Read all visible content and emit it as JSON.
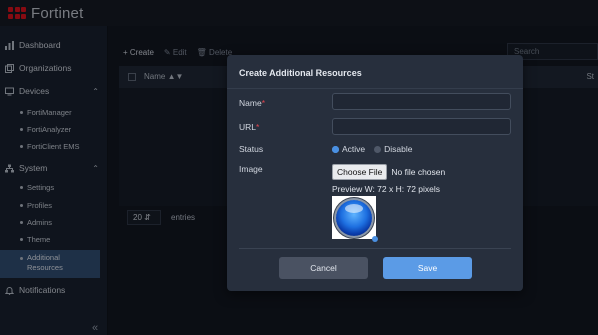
{
  "brand": {
    "name": "Fortinet",
    "accent": "#d0111d"
  },
  "sidebar": {
    "items": [
      {
        "label": "Dashboard",
        "icon": "dashboard-icon"
      },
      {
        "label": "Organizations",
        "icon": "organizations-icon"
      },
      {
        "label": "Devices",
        "icon": "devices-icon",
        "expanded": true
      },
      {
        "label": "FortiManager"
      },
      {
        "label": "FortiAnalyzer"
      },
      {
        "label": "FortiClient EMS"
      },
      {
        "label": "System",
        "icon": "system-icon",
        "expanded": true
      },
      {
        "label": "Settings"
      },
      {
        "label": "Profiles"
      },
      {
        "label": "Admins"
      },
      {
        "label": "Theme"
      },
      {
        "label": "Additional Resources",
        "active": true
      },
      {
        "label": "Notifications",
        "icon": "bell-icon"
      }
    ],
    "collapse_icon": "double-chevron-left-icon"
  },
  "main": {
    "toolbar": {
      "create": "Create",
      "edit": "Edit",
      "delete": "Delete"
    },
    "search_placeholder": "Search",
    "columns": {
      "name": "Name",
      "status": "St"
    },
    "page_size": "20",
    "entries_label": "entries"
  },
  "modal": {
    "title": "Create Additional Resources",
    "fields": {
      "name_label": "Name",
      "name_value": "",
      "url_label": "URL",
      "url_value": "",
      "status_label": "Status",
      "status_active": "Active",
      "status_disable": "Disable",
      "status_selected": "Active",
      "image_label": "Image",
      "choose_file": "Choose File",
      "file_status": "No file chosen",
      "preview_text": "Preview W: 72 x H: 72 pixels"
    },
    "cancel_label": "Cancel",
    "save_label": "Save",
    "colors": {
      "primary": "#5b9be6",
      "required": "#e2454f"
    }
  }
}
